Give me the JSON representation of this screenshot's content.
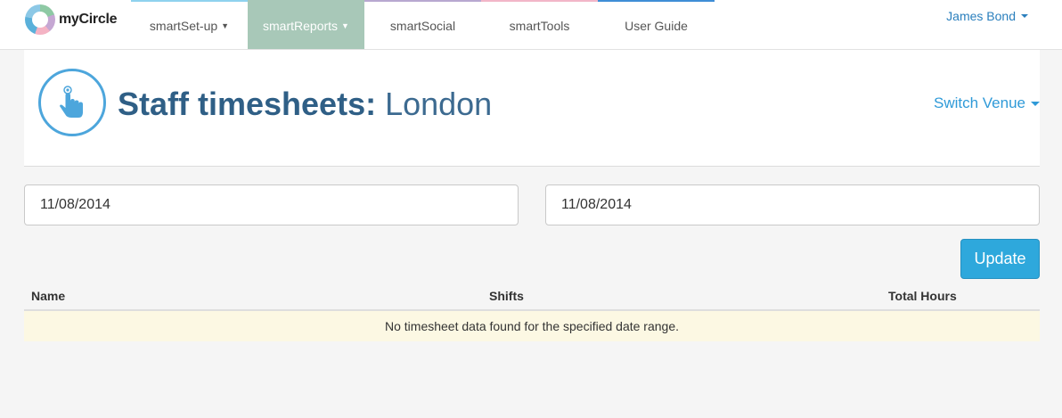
{
  "app": {
    "logo_text": "myCircle"
  },
  "nav": {
    "items": [
      {
        "label": "smartSet-up",
        "caret": "▼"
      },
      {
        "label": "smartReports",
        "caret": "▼"
      },
      {
        "label": "smartSocial"
      },
      {
        "label": "smartTools"
      },
      {
        "label": "User Guide"
      }
    ],
    "active": "smartReports",
    "accent_colors": [
      "#8fd2ee",
      "#a8c8b8",
      "#b8a8d0",
      "#f2b6c8",
      "#3f8ed6"
    ]
  },
  "user": {
    "name": "James Bond"
  },
  "header": {
    "icon": "touch-hand-icon",
    "title_bold": "Staff timesheets:",
    "title_venue": "London",
    "switch_venue_label": "Switch Venue"
  },
  "filters": {
    "date_from": "11/08/2014",
    "date_to": "11/08/2014",
    "update_label": "Update"
  },
  "table": {
    "columns": [
      "Name",
      "Shifts",
      "Total Hours"
    ],
    "empty_message": "No timesheet data found for the specified date range."
  },
  "colors": {
    "primary_button": "#2ea8dc",
    "title": "#2f5f86",
    "link": "#2f9ad8",
    "empty_row_bg": "#fcf8e3"
  }
}
